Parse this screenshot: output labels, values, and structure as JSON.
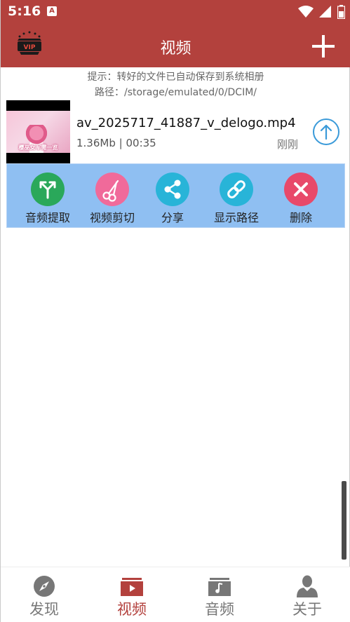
{
  "status_bar": {
    "time": "5:16",
    "notification_letter": "A"
  },
  "app_bar": {
    "title": "视频",
    "vip_icon": "vip-crown-icon",
    "vip_text": "VIP",
    "add_icon": "plus-icon"
  },
  "hint": {
    "line1": "提示：转好的文件已自动保存到系统相册",
    "line2": "路径：/storage/emulated/0/DCIM/"
  },
  "video": {
    "file_name": "av_2025717_41887_v_delogo.mp4",
    "size": "1.36Mb",
    "separator": "|",
    "duration": "00:35",
    "time_ago": "刚刚",
    "thumbnail_caption": "樱巫女军需一览"
  },
  "actions": [
    {
      "label": "音频提取",
      "icon": "split-arrows-icon",
      "color": "#2aa85a"
    },
    {
      "label": "视频剪切",
      "icon": "scissors-icon",
      "color": "#f06a9a"
    },
    {
      "label": "分享",
      "icon": "share-icon",
      "color": "#28b4d8"
    },
    {
      "label": "显示路径",
      "icon": "link-icon",
      "color": "#28b4d8"
    },
    {
      "label": "删除",
      "icon": "close-icon",
      "color": "#e8496a"
    }
  ],
  "bottom_nav": {
    "items": [
      {
        "label": "发现",
        "icon": "compass-icon",
        "active": false
      },
      {
        "label": "视频",
        "icon": "video-folder-icon",
        "active": true
      },
      {
        "label": "音频",
        "icon": "music-folder-icon",
        "active": false
      },
      {
        "label": "关于",
        "icon": "person-icon",
        "active": false
      }
    ]
  },
  "colors": {
    "primary": "#b3413d",
    "action_panel": "#8fbff2",
    "upload_blue": "#3a9ad9"
  }
}
